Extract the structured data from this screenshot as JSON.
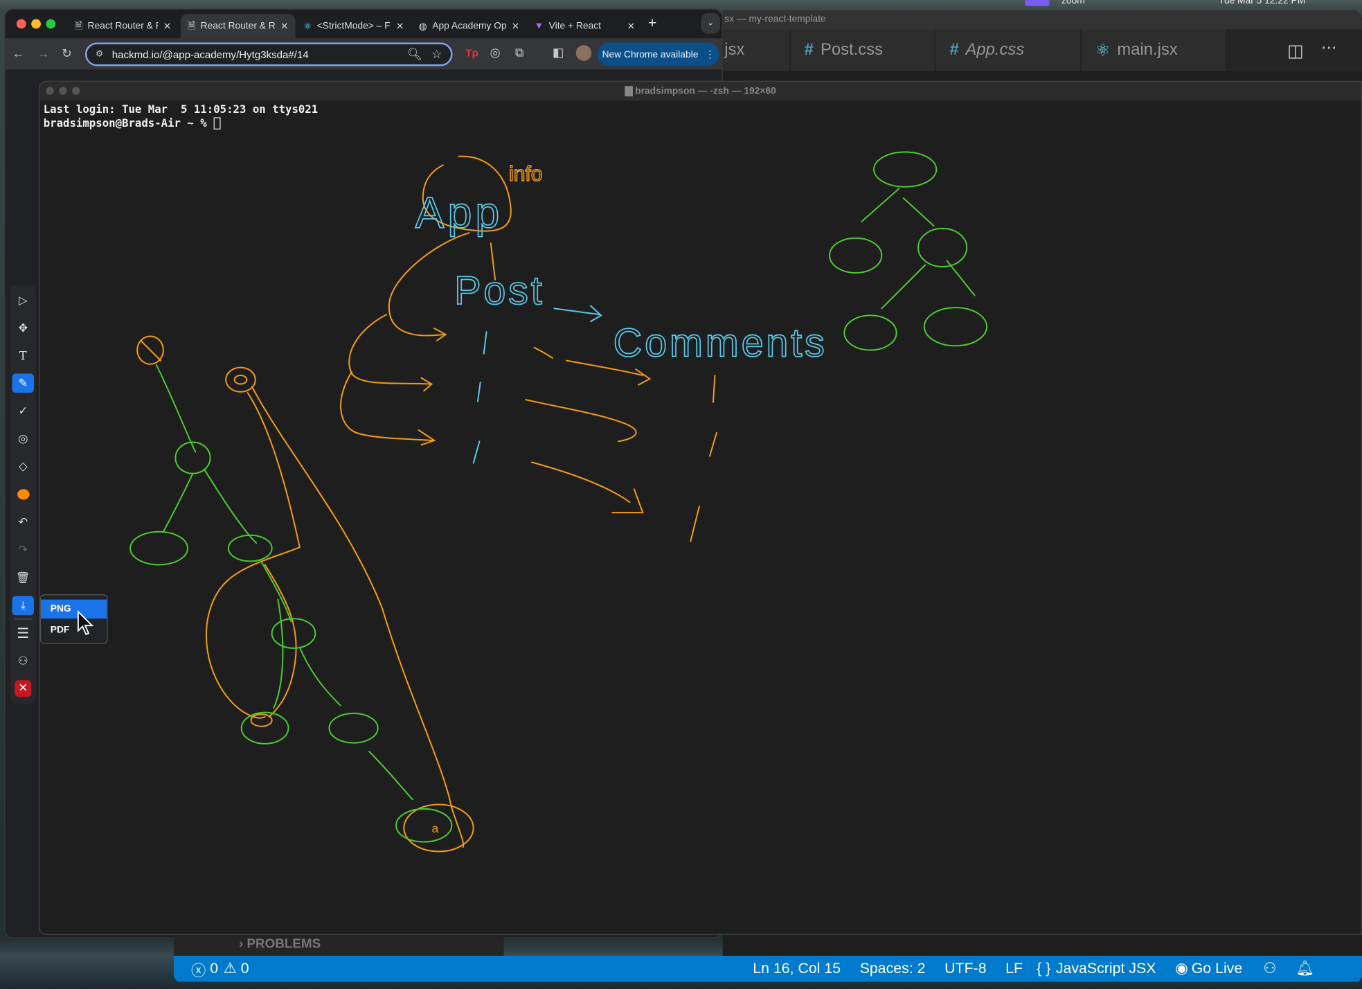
{
  "menubar": {
    "items": [
      "zoom",
      "Tue Mar 5  12:22 PM"
    ]
  },
  "chrome": {
    "tabs": [
      {
        "label": "React Router & R",
        "icon": "document-icon",
        "active": false
      },
      {
        "label": "React Router & R",
        "icon": "document-icon",
        "active": true
      },
      {
        "label": "<StrictMode> – F",
        "icon": "react-icon",
        "active": false
      },
      {
        "label": "App Academy Op",
        "icon": "globe-icon",
        "active": false
      },
      {
        "label": "Vite + React",
        "icon": "vite-icon",
        "active": false
      }
    ],
    "url": "hackmd.io/@app-academy/Hytg3ksda#/14",
    "update_button": "New Chrome available"
  },
  "vscode": {
    "title": "sx — my-react-template",
    "tabs": [
      {
        "label": "jsx",
        "icon": ""
      },
      {
        "label": "Post.css",
        "icon": "#"
      },
      {
        "label": "App.css",
        "icon": "#"
      },
      {
        "label": "main.jsx",
        "icon": "⚛"
      }
    ],
    "panel_label": "PROBLEMS",
    "status": {
      "errors": "0",
      "warnings": "0",
      "position": "Ln 16, Col 15",
      "spaces": "Spaces: 2",
      "encoding": "UTF-8",
      "eol": "LF",
      "language": "JavaScript JSX",
      "golive": "Go Live"
    },
    "status_color": "#007acc"
  },
  "terminal": {
    "title": "bradsimpson — -zsh — 192×60",
    "lines": [
      "Last login: Tue Mar  5 11:05:23 on ttys021",
      "bradsimpson@Brads-Air ~ % "
    ]
  },
  "drawing": {
    "labels": {
      "app": "App",
      "info": "info",
      "post": "Post",
      "comments": "Comments"
    },
    "colors": {
      "orange": "#f39c12",
      "green": "#4cc932",
      "cyan": "#5bc8e8"
    }
  },
  "draw_toolbar": {
    "tools": [
      "select",
      "move",
      "text",
      "pen",
      "check",
      "laser",
      "eraser",
      "color",
      "undo",
      "redo",
      "delete",
      "download",
      "menu",
      "user",
      "close"
    ],
    "active": [
      "pen",
      "download"
    ],
    "current_color": "#ff8c00",
    "export_menu": [
      "PNG",
      "PDF"
    ],
    "highlighted": "PNG"
  }
}
